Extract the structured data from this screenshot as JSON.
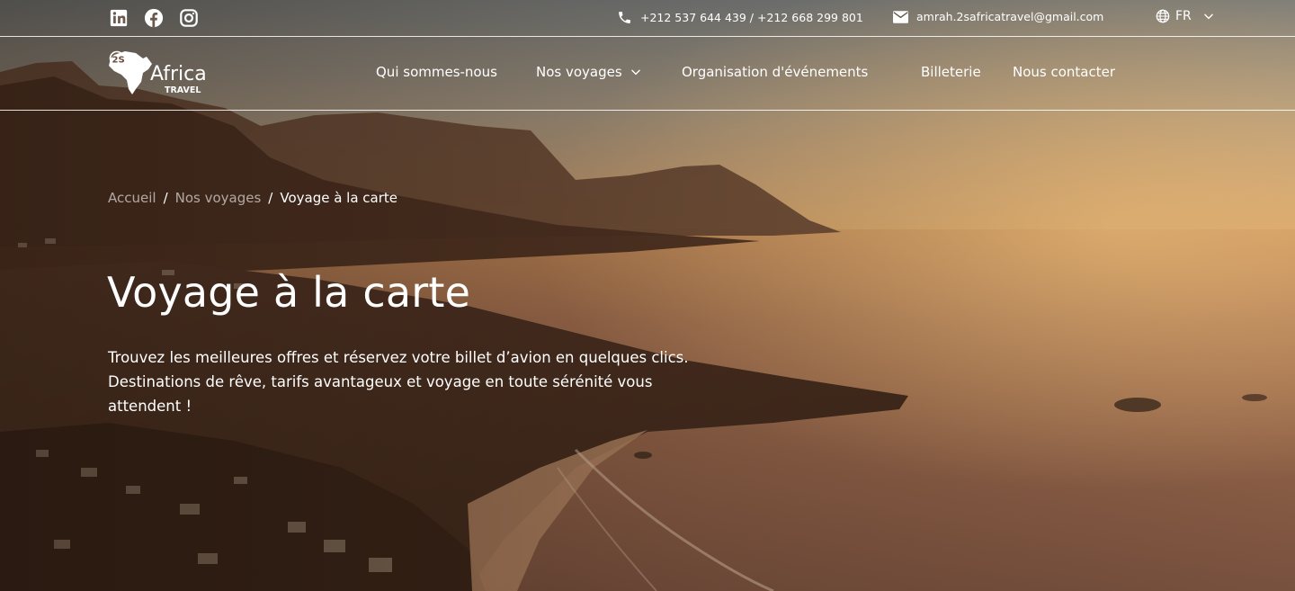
{
  "topbar": {
    "social": [
      {
        "icon": "linkedin-icon"
      },
      {
        "icon": "facebook-icon"
      },
      {
        "icon": "instagram-icon"
      }
    ],
    "phone_icon": "phone-icon",
    "phone": "+212 537 644 439 / +212 668 299 801",
    "email_icon": "mail-icon",
    "email": "amrah.2safricatravel@gmail.com",
    "language": "FR",
    "language_icon": "globe-icon"
  },
  "logo": {
    "text_main": "Africa",
    "text_sub": "TRAVEL",
    "badge": "2S"
  },
  "nav": {
    "items": [
      {
        "label": "Qui sommes-nous"
      },
      {
        "label": "Nos voyages"
      },
      {
        "label": "Organisation d'événements"
      },
      {
        "label": "Billeterie"
      },
      {
        "label": "Nous contacter"
      }
    ]
  },
  "breadcrumb": {
    "items": [
      "Accueil",
      "Nos voyages",
      "Voyage à la carte"
    ],
    "separator": "/"
  },
  "hero": {
    "title": "Voyage à la carte",
    "description": "Trouvez les meilleures offres et réservez votre billet d’avion en quelques clics. Destinations de rêve, tarifs avantageux et voyage en toute sérénité vous attendent !"
  },
  "colors": {
    "text": "#ffffff",
    "muted_text": "rgba(255,255,255,0.6)",
    "sky_top": "#8a8a86",
    "sunset_glow": "#e0a15e",
    "sea": "#9a6a4a"
  }
}
